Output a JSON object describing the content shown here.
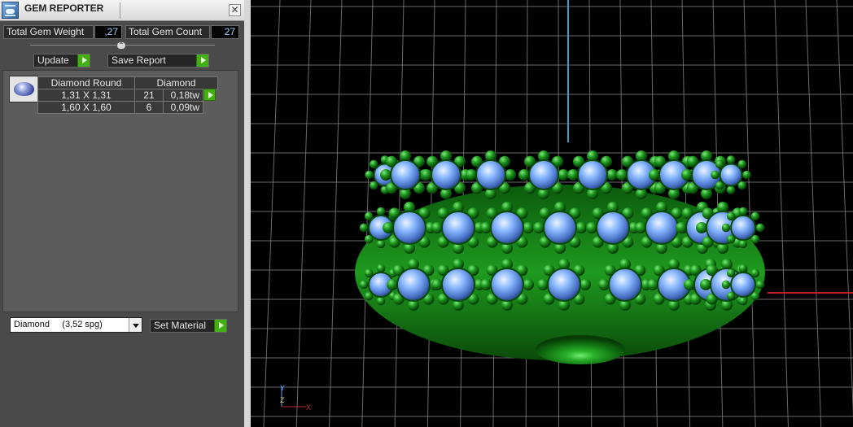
{
  "window": {
    "title": "GEM REPORTER",
    "close_glyph": "✕",
    "icon": "gem-reporter-icon"
  },
  "stats": {
    "total_weight_label": "Total Gem Weight",
    "total_weight_value": ",27",
    "total_count_label": "Total Gem Count",
    "total_count_value": "27"
  },
  "toolbar": {
    "update_label": "Update",
    "save_label": "Save Report"
  },
  "gem_table": {
    "headers": [
      "Diamond Round",
      "Diamond"
    ],
    "rows": [
      {
        "size": "1,31 X 1,31",
        "count": "21",
        "weight": "0,18tw"
      },
      {
        "size": "1,60 X 1,60",
        "count": "6",
        "weight": "0,09tw"
      }
    ]
  },
  "material": {
    "selected": "Diamond     (3,52 spg)",
    "set_label": "Set Material"
  },
  "viewport": {
    "axis_z": "Z",
    "axis_x": "X",
    "axis_y": "Y",
    "colors": {
      "metal": "#1a8a1a",
      "gem": "#8ab8ff",
      "grid": "#6a6a6a"
    }
  }
}
